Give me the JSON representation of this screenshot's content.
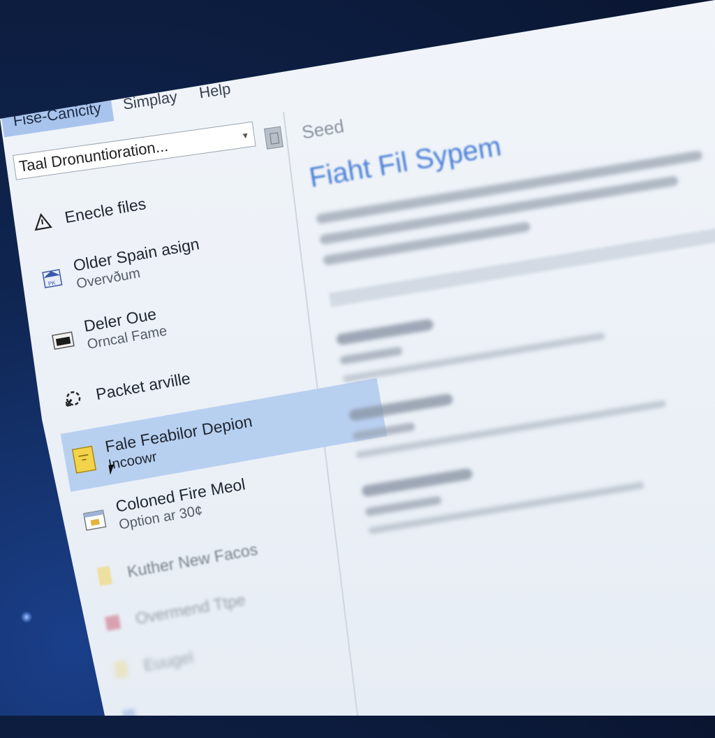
{
  "menubar": {
    "items": [
      {
        "label": "Fise-Canicity",
        "active": true
      },
      {
        "label": "Simplay",
        "active": false
      },
      {
        "label": "Help",
        "active": false
      }
    ]
  },
  "combo": {
    "value": "Taal Dronuntioration..."
  },
  "list": {
    "items": [
      {
        "title": "Enecle files",
        "subtitle": "",
        "icon": "warning-triangle-icon"
      },
      {
        "title": "Older Spain asign",
        "subtitle": "Overvðum",
        "icon": "image-file-icon"
      },
      {
        "title": "Deler Oue",
        "subtitle": "Orncal Fame",
        "icon": "folder-dark-icon"
      },
      {
        "title": "Packet arville",
        "subtitle": "",
        "icon": "gear-arrow-icon"
      },
      {
        "title": "Fale Feabilor Depion",
        "subtitle": "Incoowr",
        "icon": "yellow-document-icon",
        "selected": true
      },
      {
        "title": "Coloned Fire Meol",
        "subtitle": "Option ar 30¢",
        "icon": "calendar-icon"
      },
      {
        "title": "Kuther New Facos",
        "subtitle": "",
        "icon": "yellow-note-icon"
      },
      {
        "title": "Overmend Ttpe",
        "subtitle": "",
        "icon": "red-box-icon"
      },
      {
        "title": "Euugel",
        "subtitle": "",
        "icon": "yellow-file-icon"
      }
    ]
  },
  "right": {
    "header": "Seed",
    "title": "Fiaht Fil Sypem"
  },
  "colors": {
    "accent": "#4a7fd6",
    "selection": "#b8d0f0",
    "menu_active": "#a9c4ec"
  }
}
